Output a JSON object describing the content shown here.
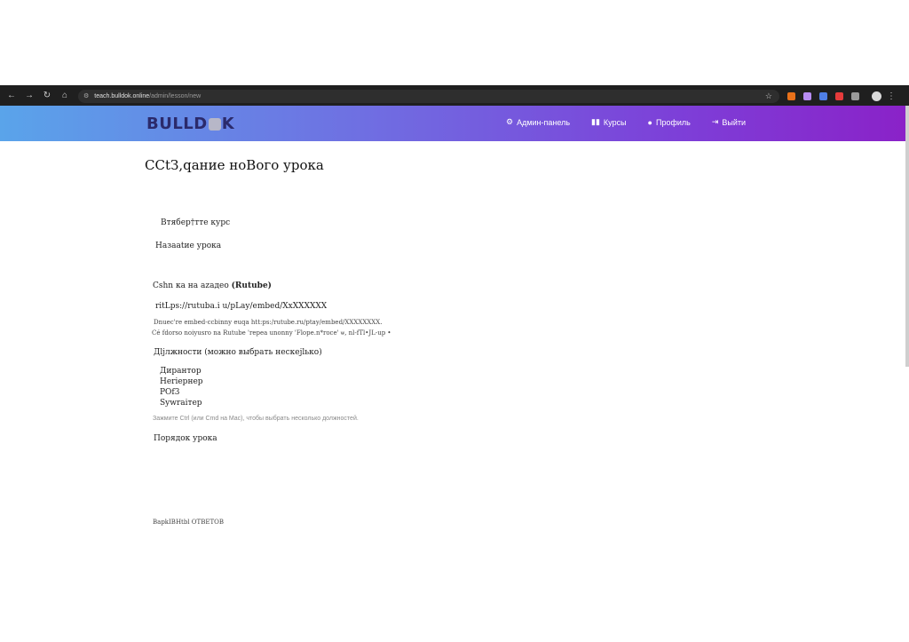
{
  "browser": {
    "url_host": "teach.bulldok.online",
    "url_path": "/admin/lesson/new"
  },
  "header": {
    "logo": "BULLDOK",
    "nav": [
      {
        "label": "Админ-панель",
        "icon": "gear-icon"
      },
      {
        "label": "Курсы",
        "icon": "book-icon"
      },
      {
        "label": "Профиль",
        "icon": "user-icon"
      },
      {
        "label": "Выйти",
        "icon": "logout-icon"
      }
    ]
  },
  "form": {
    "title": "CCtЗ,qание ноВого урока",
    "course_label": "Втябер†тте курс",
    "lesson_name_label": "Назаatие урока",
    "video_label": "Cshn ка на azадео",
    "video_label_bold": "(Rutube)",
    "video_value": "ritLps://rutuba.i u/pLay/embed/XxXXXXXX",
    "hint1": "Dnuec're embed-ccbinny euqa htt:ps:/rutube.ru/ptay/embed/XXXXXXXX.",
    "hint2": "Cé fdorso noiyusro na Rutube 'repea unonny 'Flope.n*roce' ѡ, nl-fTl•JL-up •",
    "positions_label": "Дljлжности (можно выбрать нескеjlько)",
    "positions": [
      "Дирантор",
      "Heriepнер",
      "POf3",
      "Sywraiтер"
    ],
    "positions_hint": "Зажмите Ctrl (или Cmd на Mac), чтобы выбрать несколько должностей.",
    "order_label": "Порядок урока",
    "answers_label": "BaрkIBHtbl ОТВЕТОВ"
  }
}
